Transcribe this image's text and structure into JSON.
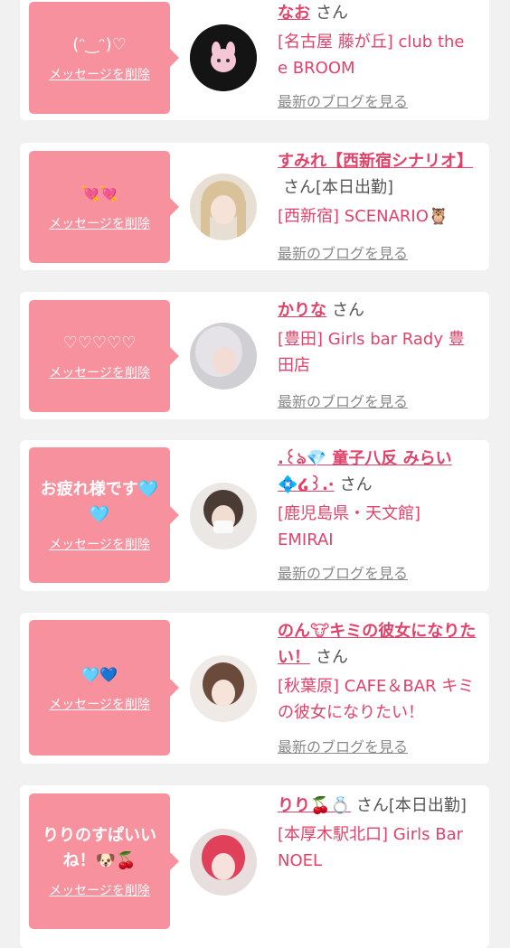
{
  "colors": {
    "accent": "#e0436a",
    "bubble": "#f7919e",
    "background": "#f1f1f1"
  },
  "delete_label": "メッセージを削除",
  "blog_label": "最新のブログを見る",
  "cards": [
    {
      "message": "(ᵔ‿ᵔ)♡",
      "name": "なお",
      "honorific": "さん",
      "shop": "[名古屋 藤が丘] club the e BROOM",
      "avatar": "avatar-dark-pink-pig"
    },
    {
      "message": "💘💘",
      "name": "すみれ【西新宿シナリオ】",
      "honorific": "さん[本日出勤]",
      "shop": "[西新宿] SCENARIO🦉",
      "avatar": "avatar-blonde"
    },
    {
      "message": "♡♡♡♡♡",
      "name": "かりな",
      "honorific": "さん",
      "shop": "[豊田] Girls bar Rady 豊田店",
      "avatar": "avatar-silver-hair"
    },
    {
      "message": "お疲れ様です🩵🩵",
      "name": ".꒰ঌ💎 童子八反 みらい 💠໒꒱.·",
      "honorific": "さん",
      "shop": "[鹿児島県・天文館] EMIRAI",
      "avatar": "avatar-mask"
    },
    {
      "message": "🩵💙",
      "name": "のん🐮キミの彼女になりたい！",
      "honorific": "さん",
      "shop": "[秋葉原] CAFE＆BAR キミの彼女になりたい！",
      "avatar": "avatar-brown-hair"
    },
    {
      "message": "りりのすぱいいね！🐶🍒",
      "name": "りり🍒💍",
      "honorific": "さん[本日出勤]",
      "shop": "[本厚木駅北口] Girls Bar NOEL",
      "avatar": "avatar-red-hair"
    }
  ]
}
